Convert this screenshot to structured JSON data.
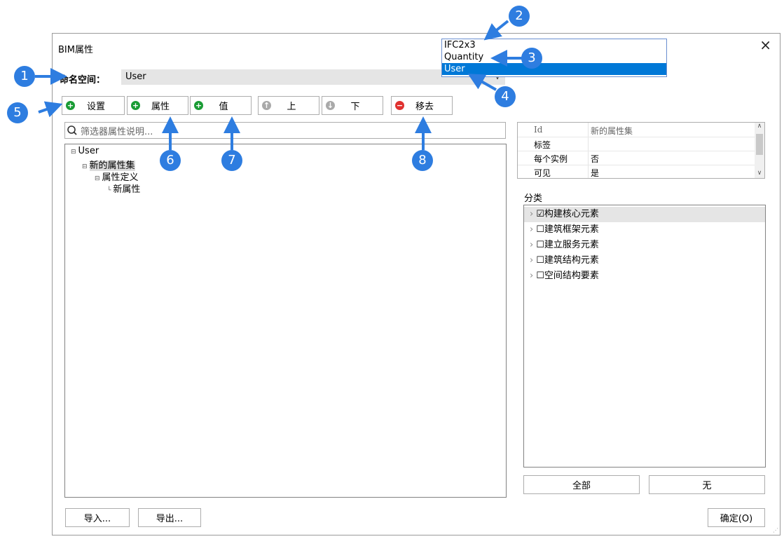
{
  "dialog": {
    "title": "BIM属性",
    "close": "×"
  },
  "namespace": {
    "label": "命名空间：",
    "value": "User",
    "arrow": "∨"
  },
  "toolbar": [
    {
      "label": "设置",
      "icon": "plus-circle-icon",
      "color": "#1a9c35"
    },
    {
      "label": "属性",
      "icon": "plus-circle-icon",
      "color": "#1a9c35"
    },
    {
      "label": "值",
      "icon": "plus-circle-icon",
      "color": "#1a9c35"
    },
    {
      "label": "上",
      "icon": "arrow-up-circle-icon",
      "color": "#a9a9a9"
    },
    {
      "label": "下",
      "icon": "arrow-down-circle-icon",
      "color": "#a9a9a9"
    },
    {
      "label": "移去",
      "icon": "minus-circle-icon",
      "color": "#e0312f"
    }
  ],
  "filter": {
    "placeholder": "筛选器属性说明..."
  },
  "tree": [
    "User",
    "新的属性集",
    "属性定义",
    "新属性"
  ],
  "props": [
    {
      "key": "Id",
      "value": "新的属性集"
    },
    {
      "key": "标签",
      "value": ""
    },
    {
      "key": "每个实例",
      "value": "否"
    },
    {
      "key": "可见",
      "value": "是"
    }
  ],
  "category": {
    "label": "分类",
    "items": [
      {
        "label": "构建核心元素",
        "checked": true
      },
      {
        "label": "建筑框架元素",
        "checked": false
      },
      {
        "label": "建立服务元素",
        "checked": false
      },
      {
        "label": "建筑结构元素",
        "checked": false
      },
      {
        "label": "空间结构要素",
        "checked": false
      }
    ],
    "all_label": "全部",
    "none_label": "无"
  },
  "footer": {
    "import_label": "导入...",
    "export_label": "导出...",
    "ok_label": "确定(O)"
  },
  "dropdown": {
    "options": [
      "IFC2x3",
      "Quantity",
      "User"
    ],
    "selected": "User"
  },
  "callouts": [
    "1",
    "2",
    "3",
    "4",
    "5",
    "6",
    "7",
    "8"
  ],
  "accent": "#2e7de0"
}
